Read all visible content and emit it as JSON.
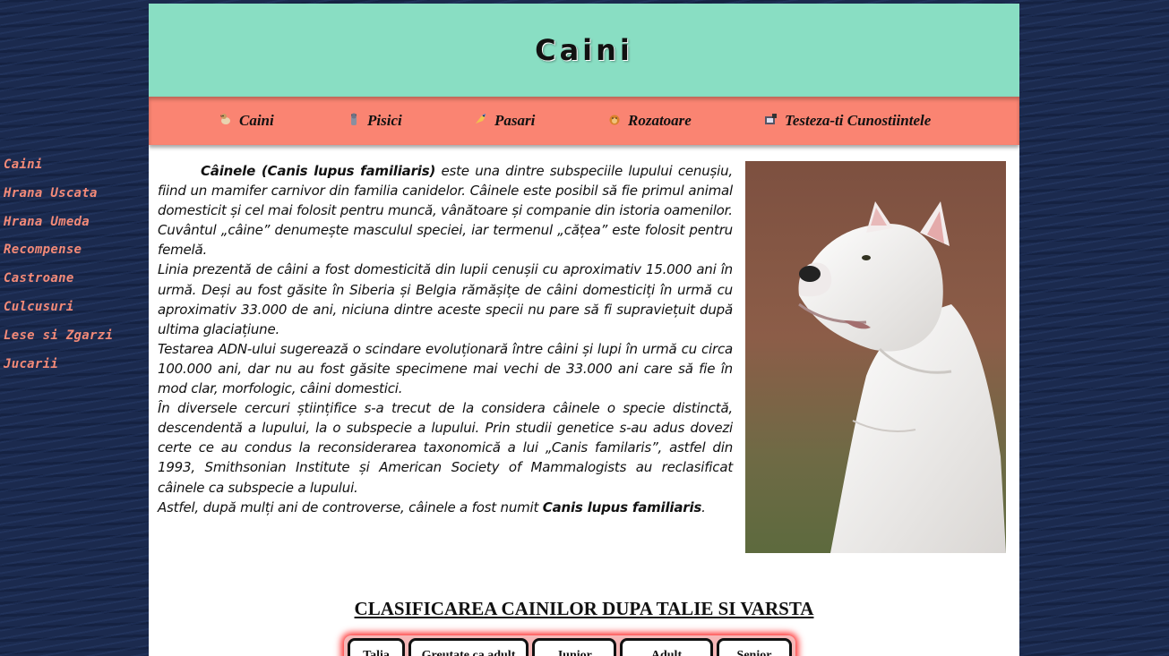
{
  "sidebar": {
    "items": [
      "Caini",
      "Hrana Uscata",
      "Hrana Umeda",
      "Recompense",
      "Castroane",
      "Culcusuri",
      "Lese si Zgarzi",
      "Jucarii"
    ]
  },
  "header": {
    "title": "Caini"
  },
  "nav": {
    "items": [
      {
        "label": "Caini",
        "icon": "dog-icon"
      },
      {
        "label": "Pisici",
        "icon": "cat-icon"
      },
      {
        "label": "Pasari",
        "icon": "bird-icon"
      },
      {
        "label": "Rozatoare",
        "icon": "hamster-icon"
      },
      {
        "label": "Testeza-ti Cunostiintele",
        "icon": "quiz-icon"
      }
    ]
  },
  "article": {
    "p1_bold": "Câinele (Canis lupus familiaris)",
    "p1_rest": " este una dintre subspeciile lupului cenușiu, fiind un mamifer carnivor din familia canidelor. Câinele este posibil să fie primul animal domesticit și cel mai folosit pentru muncă, vânătoare și companie din istoria oamenilor.",
    "p2": "Cuvântul „câine” denumește masculul speciei, iar termenul „cățea” este folosit pentru femelă.",
    "p3": "Linia prezentă de câini a fost domesticită din lupii cenușii cu aproximativ 15.000 ani în urmă. Deși au fost găsite în Siberia și Belgia rămășițe de câini domesticiți în urmă cu aproximativ 33.000 de ani, niciuna dintre aceste specii nu pare să fi supraviețuit după ultima glaciațiune.",
    "p4": "Testarea ADN-ului sugerează o scindare evoluționară între câini și lupi în urmă cu circa 100.000 ani, dar nu au fost găsite specimene mai vechi de 33.000 ani care să fie în mod clar, morfologic, câini domestici.",
    "p5": "În diversele cercuri științifice s-a trecut de la considera câinele o specie distinctă, descendentă a lupului, la o subspecie a lupului. Prin studii genetice s-au adus dovezi certe ce au condus la reconsiderarea taxonomică a lui „Canis familaris”, astfel din 1993, Smithsonian Institute și American Society of Mammalogists au reclasificat câinele ca subspecie a lupului.",
    "p6_start": "Astfel, după mulți ani de controverse, câinele a fost numit ",
    "p6_bold": "Canis lupus familiaris",
    "p6_end": "."
  },
  "section": {
    "title": "CLASIFICAREA CAINILOR DUPA TALIE SI VARSTA",
    "columns": [
      "Talia",
      "Greutate ca adult",
      "Junior",
      "Adult",
      "Senior"
    ]
  },
  "colors": {
    "header_bg": "#89dec3",
    "nav_bg": "#fa8472",
    "sidebar_text": "#f38a78",
    "page_bg": "#1b2a4e"
  }
}
